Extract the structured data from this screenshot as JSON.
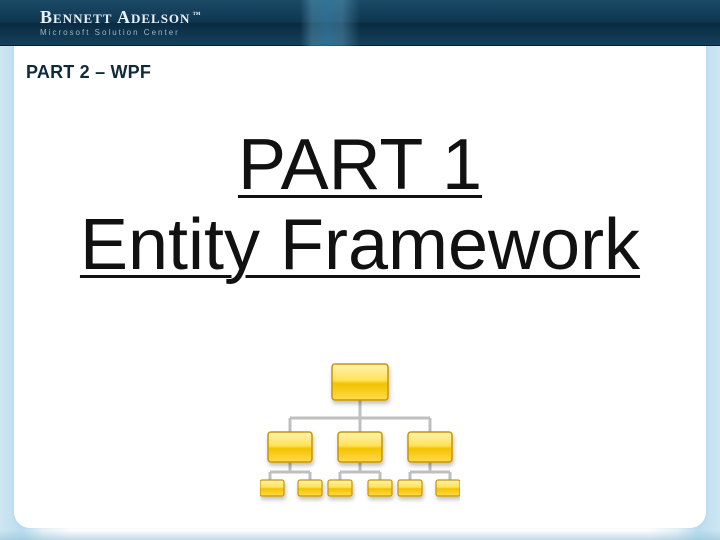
{
  "header": {
    "brand_main": "Bennett Adelson",
    "brand_tm": "™",
    "brand_sub": "Microsoft Solution Center"
  },
  "breadcrumb": "PART 2 – WPF",
  "title": {
    "line1": "PART 1",
    "line2": "Entity Framework"
  },
  "diagram": {
    "icon_name": "org-chart-icon",
    "color_fill_light": "#ffe680",
    "color_fill_dark": "#e0b000",
    "color_stroke": "#a87800",
    "connector": "#bfbfbf"
  }
}
